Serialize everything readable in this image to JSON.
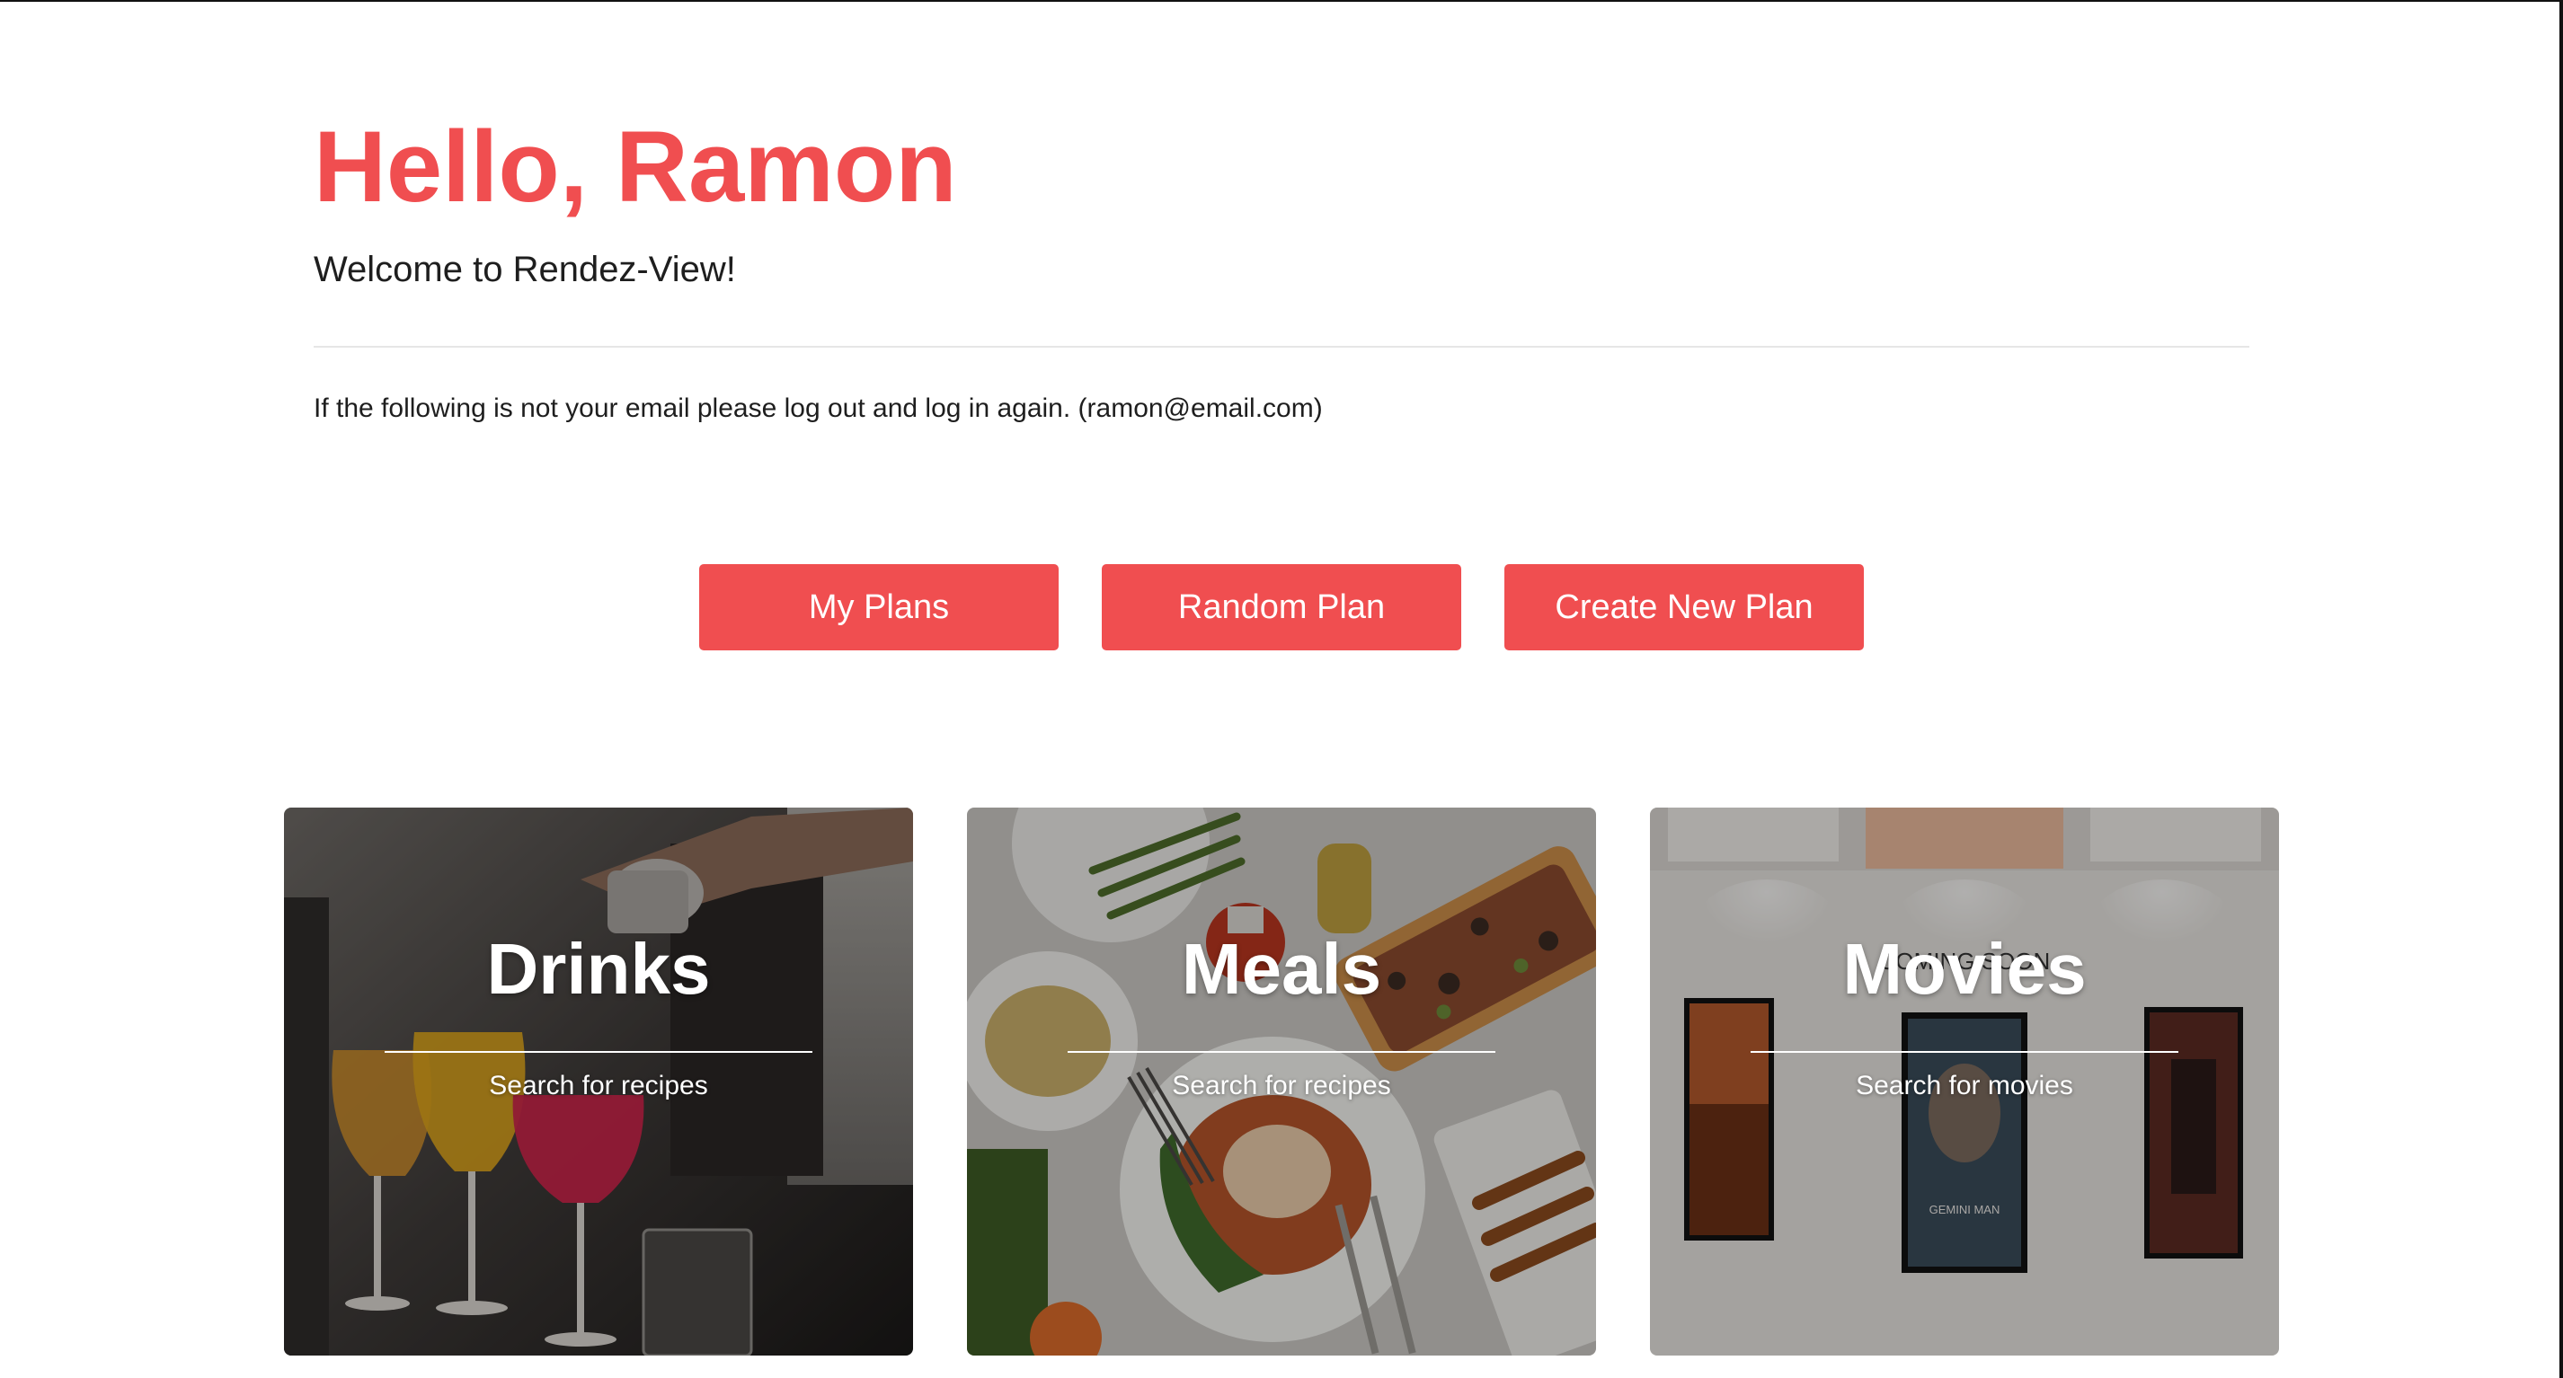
{
  "header": {
    "greeting": "Hello, Ramon",
    "welcome": "Welcome to Rendez-View!",
    "email_note": "If the following is not your email please log out and log in again. (ramon@email.com)"
  },
  "actions": {
    "my_plans": "My Plans",
    "random_plan": "Random Plan",
    "create_new_plan": "Create New Plan"
  },
  "cards": [
    {
      "title": "Drinks",
      "subtitle": "Search for recipes"
    },
    {
      "title": "Meals",
      "subtitle": "Search for recipes"
    },
    {
      "title": "Movies",
      "subtitle": "Search for movies"
    }
  ],
  "movies_card_scene": {
    "sign_text": "COMING SOON",
    "poster_caption": "GEMINI MAN"
  },
  "colors": {
    "accent": "#f04e50",
    "text": "#1e1e1e",
    "divider": "#e6e6e6"
  }
}
